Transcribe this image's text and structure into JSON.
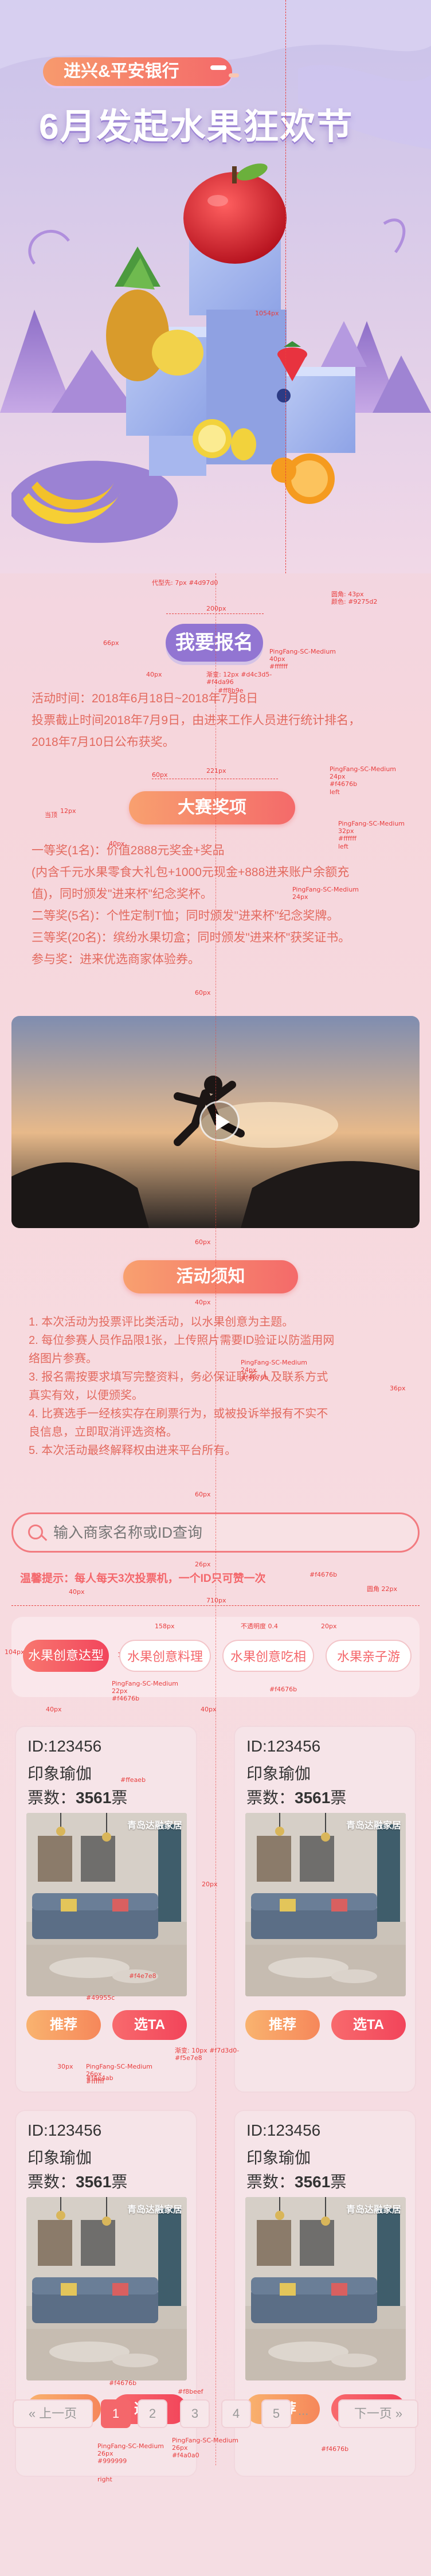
{
  "header": {
    "bank_badge": "进兴&平安银行",
    "title": "6月发起水果狂欢节"
  },
  "signup_button": "我要报名",
  "activity_time": [
    "活动时间：2018年6月18日~2018年7月8日",
    "投票截止时间2018年7月9日，由进来工作人员进行统计排名，",
    "2018年7月10日公布获奖。"
  ],
  "awards": {
    "title": "大赛奖项",
    "lines": [
      "一等奖(1名)：价值2888元奖金+奖品",
      "(内含千元水果零食大礼包+1000元现金+888进来账户余额充",
      "值)，同时颁发\"进来杯\"纪念奖杯。",
      "二等奖(5名)：个性定制T恤；同时颁发\"进来杯\"纪念奖牌。",
      "三等奖(20名)：缤纷水果切盒；同时颁发\"进来杯\"获奖证书。",
      "参与奖：进来优选商家体验券。"
    ]
  },
  "notice": {
    "title": "活动须知",
    "lines": [
      "1. 本次活动为投票评比类活动，以水果创意为主题。",
      "2. 每位参赛人员作品限1张，上传照片需要ID验证以防滥用网",
      "   络图片参赛。",
      "3. 报名需按要求填写完整资料，务必保证联系人及联系方式",
      "   真实有效，以便颁奖。",
      "4. 比赛选手一经核实存在刷票行为，或被投诉举报有不实不",
      "   良信息，立即取消评选资格。",
      "5. 本次活动最终解释权由进来平台所有。"
    ]
  },
  "search": {
    "placeholder": "输入商家名称或ID查询",
    "tip": "温馨提示：每人每天3次投票机，一个ID只可赞一次"
  },
  "tags": [
    "水果创意达型",
    "水果创意料理",
    "水果创意吃相",
    "水果亲子游"
  ],
  "cards": [
    {
      "id": "ID:123456",
      "name": "印象瑜伽",
      "votes_label": "票数：",
      "votes": "3561",
      "votes_unit": "票",
      "watermark": "青岛达融家居",
      "btn_a": "推荐",
      "btn_b": "选TA"
    },
    {
      "id": "ID:123456",
      "name": "印象瑜伽",
      "votes_label": "票数：",
      "votes": "3561",
      "votes_unit": "票",
      "watermark": "青岛达融家居",
      "btn_a": "推荐",
      "btn_b": "选TA"
    },
    {
      "id": "ID:123456",
      "name": "印象瑜伽",
      "votes_label": "票数：",
      "votes": "3561",
      "votes_unit": "票",
      "watermark": "青岛达融家居",
      "btn_a": "推荐",
      "btn_b": "选TA"
    },
    {
      "id": "ID:123456",
      "name": "印象瑜伽",
      "votes_label": "票数：",
      "votes": "3561",
      "votes_unit": "票",
      "watermark": "青岛达融家居",
      "btn_a": "推荐",
      "btn_b": "选TA"
    }
  ],
  "pagination": {
    "prev": "« 上一页",
    "pages": [
      "1",
      "2",
      "3",
      "4",
      "5"
    ],
    "ellipsis": "...",
    "next": "下一页 »",
    "active": "1"
  },
  "annotations": {
    "a_1054": "1054px",
    "a_title": "PingFang-SC-Medium\n40px\n#4a4444",
    "a_dash": "代型先: 7px #4d97d0",
    "a_radius": "圆角: 43px\n颜色: #9275d2",
    "a_66": "66px",
    "a_200": "200px",
    "a_sb": "PingFang-SC-Medium\n40px\n#ffffff",
    "a_40a": "40px",
    "a_grad": "渐变: 12px #d4c3d5-\n#f4da96",
    "a_ff8b": "#ff8b9e",
    "a_60a": "60px",
    "a_221": "221px",
    "a_pf24": "PingFang-SC-Medium\n24px\n#f4676b\nleft",
    "a_pf32": "PingFang-SC-Medium\n32px\n#ffffff\nleft",
    "a_pf24b": "PingFang-SC-Medium\n24px",
    "a_40b": "40px",
    "a_12": "12px",
    "a_gap": "当顶",
    "a_60b": "60px",
    "a_60c": "60px",
    "a_40c": "40px",
    "a_pf24c": "PingFang-SC-Medium\n24px\n#f4676b",
    "a_36": "36px",
    "a_40d": "40px",
    "a_60d": "60px",
    "a_26": "26px",
    "a_tipcolor": "#f4676b",
    "a_radius22": "圆角 22px",
    "a_40e": "40px",
    "a_710": "710px",
    "a_104": "104px",
    "a_158": "158px",
    "a_op": "不透明度 0.4",
    "a_20px": "20px",
    "a_10": "10px",
    "a_60px": "60px",
    "a_tagfont": "PingFang-SC-Medium\n22px\n#f4676b",
    "a_f4676b": "#f4676b",
    "a_40f": "40px",
    "a_40g": "40px",
    "a_ffeaeb": "#ffeaeb",
    "a_20c": "20px",
    "a_e7d": "#f4e7e8",
    "a_49955c": "#49955c",
    "a_30px": "30px",
    "a_btnfont": "PingFang-SC-Medium\n26px\n#ffffff",
    "a_btngrad": "渐变: 10px #f7d3d0-\n#f5e7e8",
    "a_4e4ab": "#f4e4ab",
    "a_f4676bb": "#f4676b",
    "a_f8beef": "#f8beef",
    "a_f4676bc": "#f4676b",
    "a_pgfont": "PingFang-SC-Medium\n26px\n#999999",
    "a_pgfont2": "PingFang-SC-Medium\n26px\n#f4a0a0",
    "a_right": "right"
  }
}
